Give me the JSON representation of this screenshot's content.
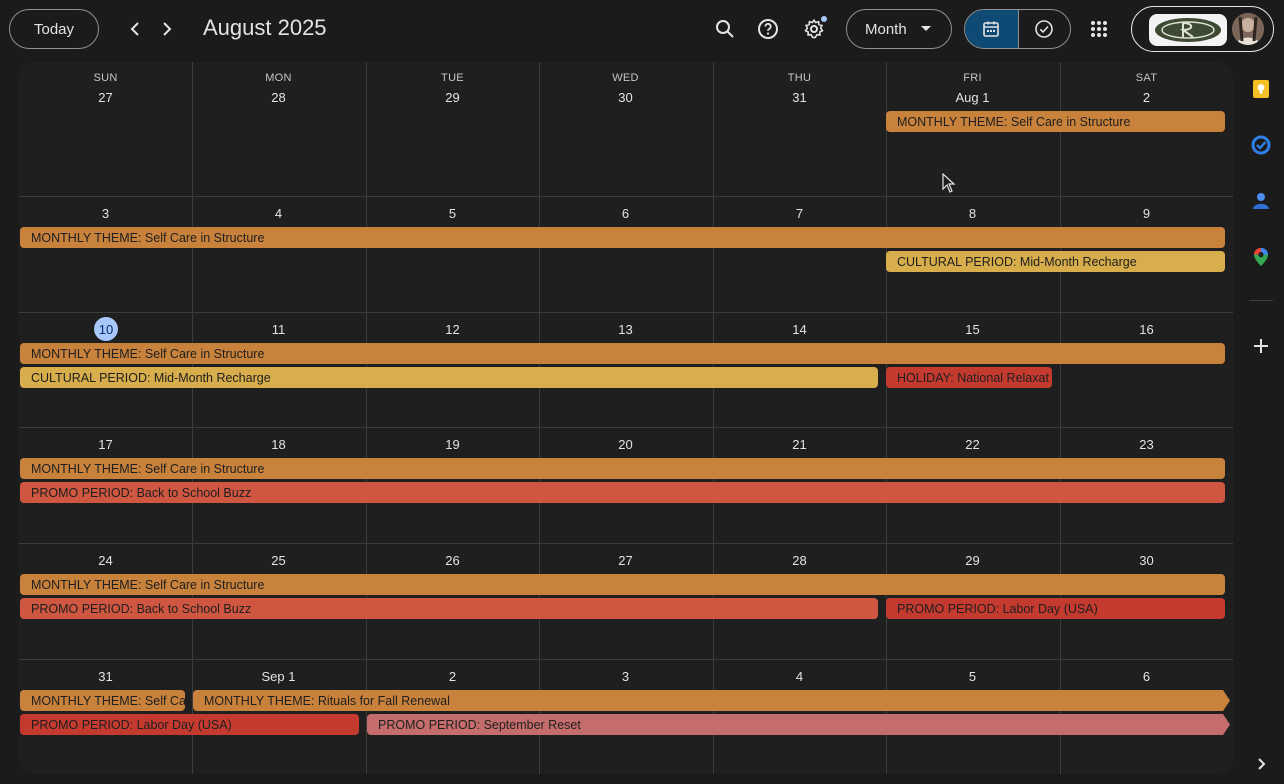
{
  "header": {
    "today_label": "Today",
    "title": "August 2025",
    "view_label": "Month"
  },
  "calendar": {
    "weekdays": [
      "SUN",
      "MON",
      "TUE",
      "WED",
      "THU",
      "FRI",
      "SAT"
    ],
    "weeks": [
      [
        "27",
        "28",
        "29",
        "30",
        "31",
        "Aug 1",
        "2"
      ],
      [
        "3",
        "4",
        "5",
        "6",
        "7",
        "8",
        "9"
      ],
      [
        "10",
        "11",
        "12",
        "13",
        "14",
        "15",
        "16"
      ],
      [
        "17",
        "18",
        "19",
        "20",
        "21",
        "22",
        "23"
      ],
      [
        "24",
        "25",
        "26",
        "27",
        "28",
        "29",
        "30"
      ],
      [
        "31",
        "Sep 1",
        "2",
        "3",
        "4",
        "5",
        "6"
      ]
    ],
    "today": "10",
    "events": {
      "w0_theme": "MONTHLY THEME: Self Care in Structure",
      "w1_theme": "MONTHLY THEME: Self Care in Structure",
      "w1_cultural": "CULTURAL PERIOD: Mid-Month Recharge",
      "w2_theme": "MONTHLY THEME: Self Care in Structure",
      "w2_cultural": "CULTURAL PERIOD: Mid-Month Recharge",
      "w2_holiday": "HOLIDAY: National Relaxat",
      "w3_theme": "MONTHLY THEME: Self Care in Structure",
      "w3_promo": "PROMO PERIOD: Back to School Buzz",
      "w4_theme": "MONTHLY THEME: Self Care in Structure",
      "w4_promo": "PROMO PERIOD: Back to School Buzz",
      "w4_labor": "PROMO PERIOD: Labor Day (USA)",
      "w5_theme_a": "MONTHLY THEME: Self Ca",
      "w5_theme_b": "MONTHLY THEME: Rituals for Fall Renewal",
      "w5_labor": "PROMO PERIOD: Labor Day (USA)",
      "w5_sept": "PROMO PERIOD: September Reset"
    }
  },
  "colors": {
    "theme": "#c8823c",
    "cultural": "#d8ad4b",
    "holiday": "#c53a2f",
    "promo": "#cf5640",
    "promo_sept": "#c56d6d",
    "today_accent": "#a8c7fa"
  }
}
